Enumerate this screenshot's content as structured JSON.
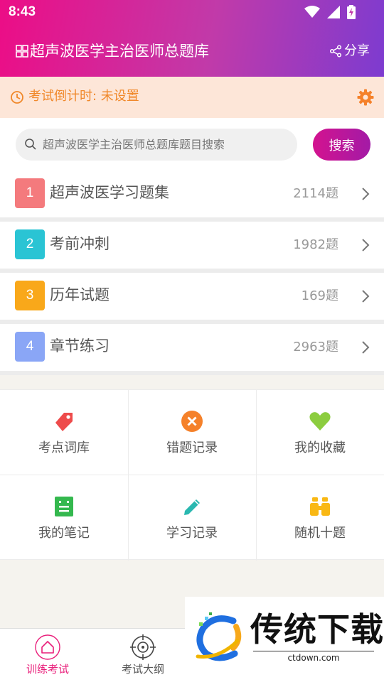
{
  "status_bar": {
    "time": "8:43"
  },
  "header": {
    "title": "超声波医学主治医师总题库",
    "share_label": "分享"
  },
  "countdown": {
    "text": "考试倒计时: 未设置"
  },
  "search": {
    "placeholder": "超声波医学主治医师总题库题目搜索",
    "value": "",
    "button_label": "搜索"
  },
  "categories": [
    {
      "num": "1",
      "label": "超声波医学习题集",
      "count": "2114题",
      "color": "#f47a7d"
    },
    {
      "num": "2",
      "label": "考前冲刺",
      "count": "1982题",
      "color": "#2ac4d4"
    },
    {
      "num": "3",
      "label": "历年试题",
      "count": "169题",
      "color": "#f9a81a"
    },
    {
      "num": "4",
      "label": "章节练习",
      "count": "2963题",
      "color": "#8aa6f6"
    }
  ],
  "tools": [
    {
      "label": "考点词库",
      "icon": "tag-icon",
      "color": "#ee4b4b"
    },
    {
      "label": "错题记录",
      "icon": "x-circle-icon",
      "color": "#f5812a"
    },
    {
      "label": "我的收藏",
      "icon": "heart-icon",
      "color": "#8ccd3f"
    },
    {
      "label": "我的笔记",
      "icon": "note-icon",
      "color": "#34b84e"
    },
    {
      "label": "学习记录",
      "icon": "pencil-icon",
      "color": "#29b8b0"
    },
    {
      "label": "随机十题",
      "icon": "binoculars-icon",
      "color": "#f9b814"
    }
  ],
  "bottom_nav": [
    {
      "label": "训练考试",
      "icon": "home-icon",
      "active": true
    },
    {
      "label": "考试大纲",
      "icon": "target-icon",
      "active": false
    }
  ],
  "watermark": {
    "text": "传统下载",
    "url": "ctdown.com"
  },
  "colors": {
    "brand_pink": "#ec0d86",
    "brand_purple": "#7d3bd0",
    "accent_orange": "#f0882a",
    "nav_active": "#e91e7a"
  }
}
